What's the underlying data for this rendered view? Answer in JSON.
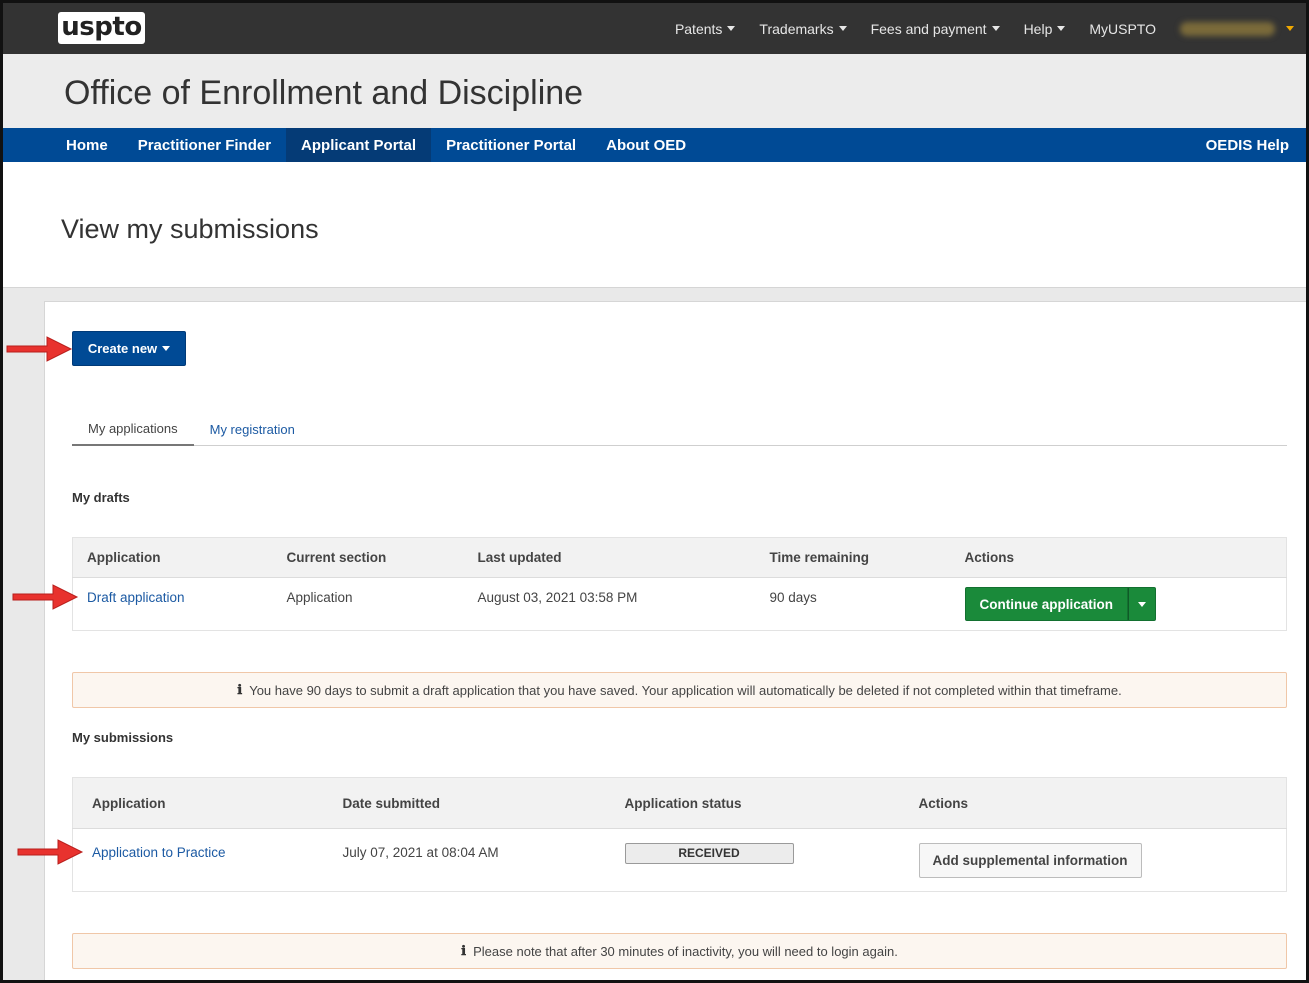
{
  "topbar": {
    "logo": "uspto",
    "nav": [
      {
        "label": "Patents",
        "dropdown": true
      },
      {
        "label": "Trademarks",
        "dropdown": true
      },
      {
        "label": "Fees and payment",
        "dropdown": true
      },
      {
        "label": "Help",
        "dropdown": true
      },
      {
        "label": "MyUSPTO",
        "dropdown": false
      }
    ]
  },
  "header": {
    "title": "Office of Enrollment and Discipline"
  },
  "mainnav": {
    "items": [
      {
        "label": "Home"
      },
      {
        "label": "Practitioner Finder"
      },
      {
        "label": "Applicant Portal"
      },
      {
        "label": "Practitioner Portal"
      },
      {
        "label": "About OED"
      }
    ],
    "help": "OEDIS Help"
  },
  "page": {
    "title": "View my submissions"
  },
  "actions": {
    "create_new": "Create new"
  },
  "tabs": [
    {
      "label": "My applications"
    },
    {
      "label": "My registration"
    }
  ],
  "drafts": {
    "title": "My drafts",
    "columns": [
      "Application",
      "Current section",
      "Last updated",
      "Time remaining",
      "Actions"
    ],
    "rows": [
      {
        "application": "Draft application",
        "section": "Application",
        "updated": "August 03, 2021 03:58 PM",
        "remaining": "90 days",
        "action": "Continue application"
      }
    ]
  },
  "notice_drafts": "You have 90 days to submit a draft application that you have saved. Your application will automatically be deleted if not completed within that timeframe.",
  "submissions": {
    "title": "My submissions",
    "columns": [
      "Application",
      "Date submitted",
      "Application status",
      "Actions"
    ],
    "rows": [
      {
        "application": "Application to Practice",
        "date": "July 07, 2021 at 08:04 AM",
        "status": "RECEIVED",
        "action": "Add supplemental information"
      }
    ]
  },
  "notice_session": "Please note that after 30 minutes of inactivity, you will need to login again.",
  "colors": {
    "topbar": "#333333",
    "mainnav": "#004a95",
    "primary_button": "#004a95",
    "success_button": "#1a8a3a",
    "link": "#1c5aa3",
    "annotation_arrow": "#e8322e"
  }
}
